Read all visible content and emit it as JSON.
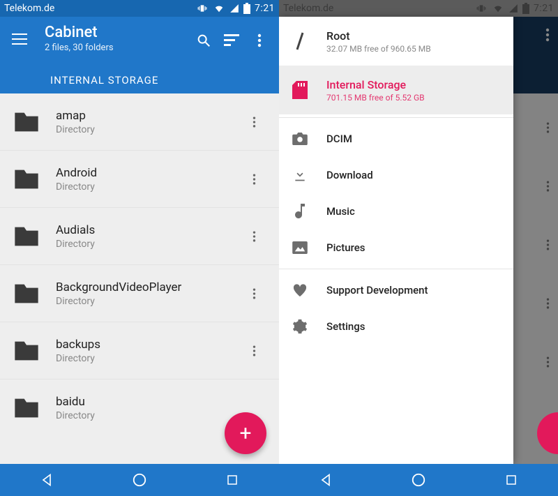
{
  "status": {
    "carrier": "Telekom.de",
    "time": "7:21"
  },
  "screen1": {
    "title": "Cabinet",
    "subtitle": "2 files, 30 folders",
    "breadcrumb": "INTERNAL STORAGE",
    "items": [
      {
        "name": "amap",
        "sub": "Directory"
      },
      {
        "name": "Android",
        "sub": "Directory"
      },
      {
        "name": "Audials",
        "sub": "Directory"
      },
      {
        "name": "BackgroundVideoPlayer",
        "sub": "Directory"
      },
      {
        "name": "backups",
        "sub": "Directory"
      },
      {
        "name": "baidu",
        "sub": "Directory"
      }
    ]
  },
  "drawer": {
    "storages": [
      {
        "name": "Root",
        "sub": "32.07 MB free of 960.65 MB",
        "icon": "slash",
        "active": false
      },
      {
        "name": "Internal Storage",
        "sub": "701.15 MB free of 5.52 GB",
        "icon": "sdcard",
        "active": true
      }
    ],
    "shortcuts": [
      {
        "name": "DCIM",
        "icon": "camera"
      },
      {
        "name": "Download",
        "icon": "download"
      },
      {
        "name": "Music",
        "icon": "music"
      },
      {
        "name": "Pictures",
        "icon": "picture"
      }
    ],
    "misc": [
      {
        "name": "Support Development",
        "icon": "heart"
      },
      {
        "name": "Settings",
        "icon": "gear"
      }
    ]
  },
  "colors": {
    "primary": "#2077C9",
    "primaryDark": "#1767B0",
    "accent": "#E2195B"
  }
}
